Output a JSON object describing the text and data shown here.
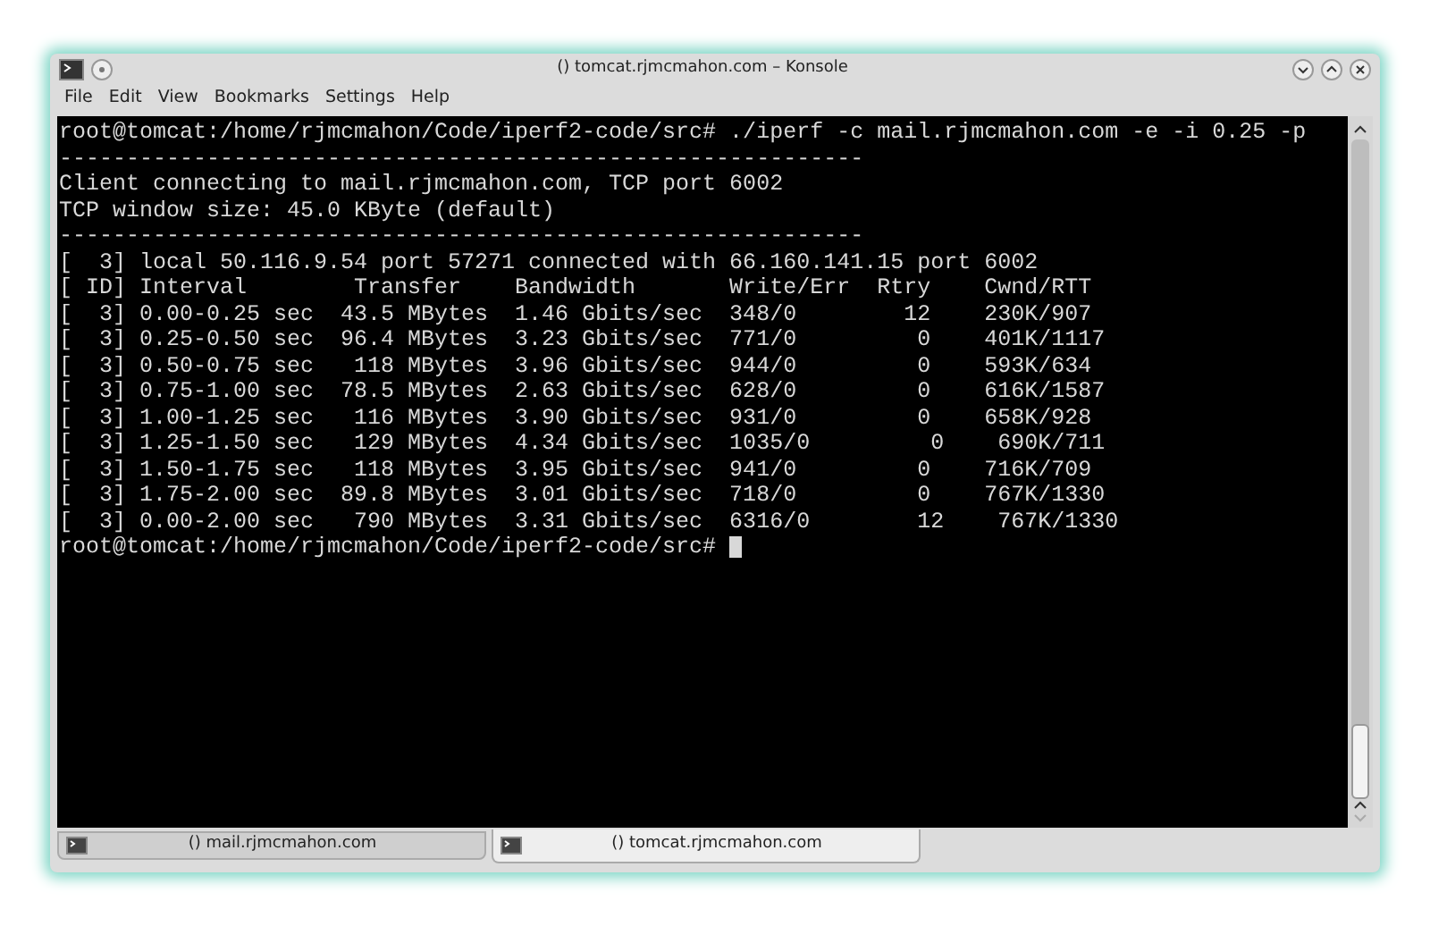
{
  "window": {
    "title": "() tomcat.rjmcmahon.com – Konsole"
  },
  "menu": [
    "File",
    "Edit",
    "View",
    "Bookmarks",
    "Settings",
    "Help"
  ],
  "terminal_lines": [
    "root@tomcat:/home/rjmcmahon/Code/iperf2-code/src# ./iperf -c mail.rjmcmahon.com -e -i 0.25 -p",
    "------------------------------------------------------------",
    "Client connecting to mail.rjmcmahon.com, TCP port 6002",
    "TCP window size: 45.0 KByte (default)",
    "------------------------------------------------------------",
    "[  3] local 50.116.9.54 port 57271 connected with 66.160.141.15 port 6002",
    "[ ID] Interval        Transfer    Bandwidth       Write/Err  Rtry    Cwnd/RTT",
    "[  3] 0.00-0.25 sec  43.5 MBytes  1.46 Gbits/sec  348/0        12    230K/907",
    "[  3] 0.25-0.50 sec  96.4 MBytes  3.23 Gbits/sec  771/0         0    401K/1117",
    "[  3] 0.50-0.75 sec   118 MBytes  3.96 Gbits/sec  944/0         0    593K/634",
    "[  3] 0.75-1.00 sec  78.5 MBytes  2.63 Gbits/sec  628/0         0    616K/1587",
    "[  3] 1.00-1.25 sec   116 MBytes  3.90 Gbits/sec  931/0         0    658K/928",
    "[  3] 1.25-1.50 sec   129 MBytes  4.34 Gbits/sec  1035/0         0    690K/711",
    "[  3] 1.50-1.75 sec   118 MBytes  3.95 Gbits/sec  941/0         0    716K/709",
    "[  3] 1.75-2.00 sec  89.8 MBytes  3.01 Gbits/sec  718/0         0    767K/1330",
    "[  3] 0.00-2.00 sec   790 MBytes  3.31 Gbits/sec  6316/0        12    767K/1330"
  ],
  "prompt": "root@tomcat:/home/rjmcmahon/Code/iperf2-code/src#",
  "tabs": [
    {
      "label": "() mail.rjmcmahon.com",
      "selected": false
    },
    {
      "label": "() tomcat.rjmcmahon.com",
      "selected": true
    }
  ]
}
